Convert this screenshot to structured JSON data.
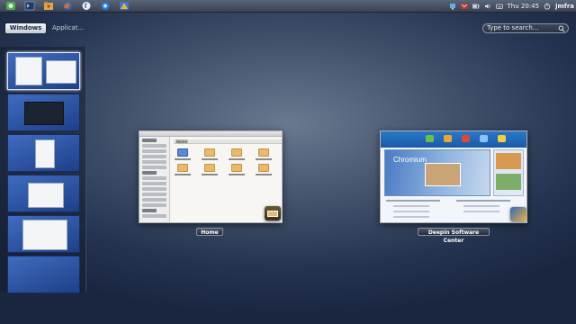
{
  "top_panel": {
    "launchers": [
      {
        "icon": "menu-icon",
        "color": "#4caf50"
      },
      {
        "icon": "terminal-icon",
        "color": "#2b4a7a"
      },
      {
        "icon": "file-manager-icon",
        "color": "#d9a84e"
      },
      {
        "icon": "firefox-icon",
        "color": "#e66a1e"
      },
      {
        "icon": "fedora-icon",
        "color": "#2c5aa0"
      },
      {
        "icon": "chromium-icon",
        "color": "#2a7ad6"
      },
      {
        "icon": "software-center-icon",
        "color": "#f0b03a"
      }
    ],
    "clock": "Thu 20:45",
    "user": "jmfra"
  },
  "overview": {
    "tab_windows": "Windows",
    "tab_applications": "Applicat...",
    "search_placeholder": "Type to search..."
  },
  "workspaces": {
    "count": 6,
    "active_index": 0
  },
  "windows": [
    {
      "caption": "Home",
      "folder_label": "Home"
    },
    {
      "caption": "Deepin Software Center",
      "banner_title": "Chromium"
    }
  ]
}
